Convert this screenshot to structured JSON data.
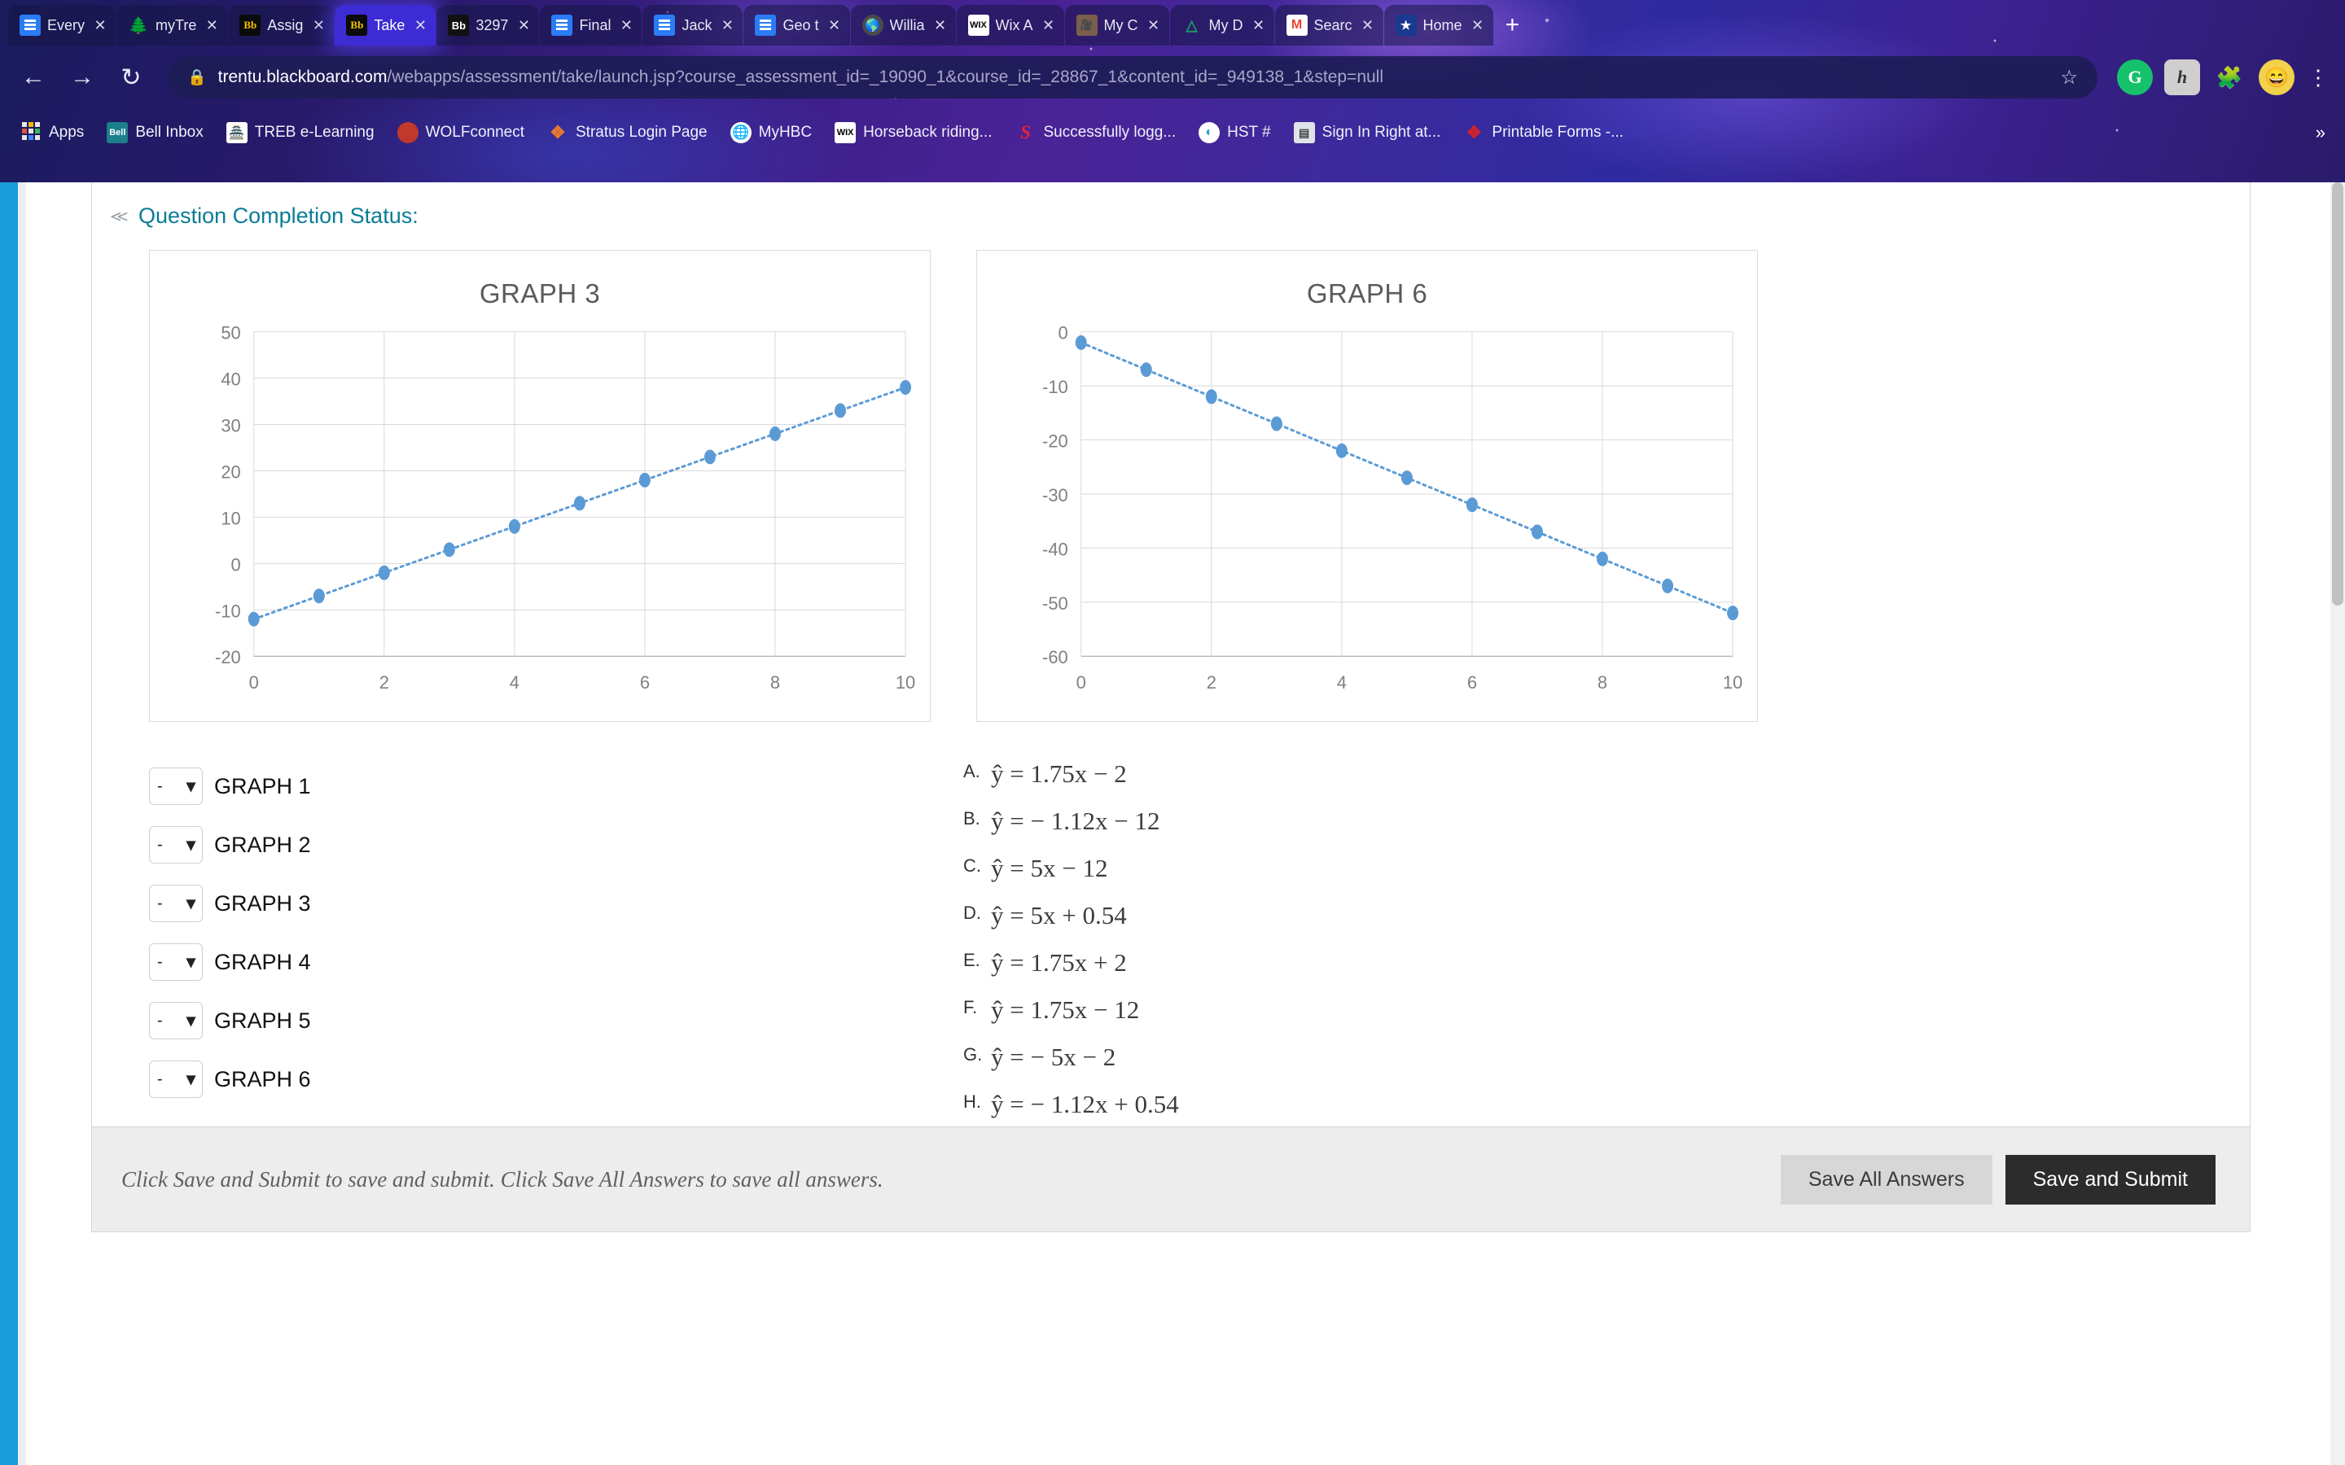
{
  "browser": {
    "tabs": [
      {
        "label": "Every",
        "icon": "google-docs-icon",
        "active": false
      },
      {
        "label": "myTre",
        "icon": "tree-icon",
        "active": false
      },
      {
        "label": "Assig",
        "icon": "blackboard-icon",
        "active": false
      },
      {
        "label": "Take",
        "icon": "blackboard-icon",
        "active": true
      },
      {
        "label": "3297",
        "icon": "blackboard-dark-icon",
        "active": false
      },
      {
        "label": "Final",
        "icon": "google-docs-icon",
        "active": false
      },
      {
        "label": "Jack",
        "icon": "google-docs-icon",
        "active": false
      },
      {
        "label": "Geo t",
        "icon": "google-docs-icon",
        "active": false
      },
      {
        "label": "Willia",
        "icon": "globe-icon",
        "active": false
      },
      {
        "label": "Wix A",
        "icon": "wix-icon",
        "active": false
      },
      {
        "label": "My C",
        "icon": "video-icon",
        "active": false
      },
      {
        "label": "My D",
        "icon": "google-drive-icon",
        "active": false
      },
      {
        "label": "Searc",
        "icon": "gmail-icon",
        "active": false
      },
      {
        "label": "Home",
        "icon": "star-icon",
        "active": false
      }
    ],
    "new_tab_label": "+",
    "tab_close_label": "✕",
    "nav": {
      "back": "←",
      "forward": "→",
      "reload": "↻"
    },
    "omnibox": {
      "lock_icon": "lock-icon",
      "host": "trentu.blackboard.com",
      "path": "/webapps/assessment/take/launch.jsp?course_assessment_id=_19090_1&course_id=_28867_1&content_id=_949138_1&step=null",
      "bookmark_star": "☆"
    },
    "extensions": [
      {
        "name": "grammarly-extension-icon",
        "glyph": "G"
      },
      {
        "name": "hypothesis-extension-icon",
        "glyph": "h"
      },
      {
        "name": "extensions-puzzle-icon",
        "glyph": "🧩"
      },
      {
        "name": "profile-avatar",
        "glyph": "😄"
      }
    ],
    "menu_icon": "⋮",
    "bookmarks": [
      {
        "label": "Apps",
        "icon": "apps-grid-icon"
      },
      {
        "label": "Bell Inbox",
        "icon": "bell-icon",
        "glyph": "Bell"
      },
      {
        "label": "TREB e-Learning",
        "icon": "treb-tower-icon",
        "glyph": "🗼"
      },
      {
        "label": "WOLFconnect",
        "icon": "wolf-icon",
        "glyph": ""
      },
      {
        "label": "Stratus Login Page",
        "icon": "stratus-diamond-icon",
        "glyph": "❖"
      },
      {
        "label": "MyHBC",
        "icon": "globe-icon",
        "glyph": "🌐"
      },
      {
        "label": "Horseback riding...",
        "icon": "wix-icon",
        "glyph": "WIX"
      },
      {
        "label": "Successfully logg...",
        "icon": "s-swirl-icon",
        "glyph": "S"
      },
      {
        "label": "HST #",
        "icon": "hst-icon",
        "glyph": "◔"
      },
      {
        "label": "Sign In   Right at...",
        "icon": "signin-icon",
        "glyph": "▤"
      },
      {
        "label": "Printable Forms -...",
        "icon": "printable-forms-icon",
        "glyph": "❖"
      }
    ],
    "bookmarks_overflow": "»"
  },
  "content": {
    "question_completion_status": "Question Completion Status:",
    "collapse_chevron": "»",
    "graph_labels": [
      "GRAPH 1",
      "GRAPH 2",
      "GRAPH 3",
      "GRAPH 4",
      "GRAPH 5",
      "GRAPH 6"
    ],
    "dropdown_selected": "-",
    "dropdown_caret": "⌄",
    "options": [
      {
        "letter": "A.",
        "equation": "ŷ =  1.75x − 2"
      },
      {
        "letter": "B.",
        "equation": "ŷ = − 1.12x − 12"
      },
      {
        "letter": "C.",
        "equation": "ŷ =  5x − 12"
      },
      {
        "letter": "D.",
        "equation": "ŷ =  5x + 0.54"
      },
      {
        "letter": "E.",
        "equation": "ŷ =  1.75x + 2"
      },
      {
        "letter": "F.",
        "equation": "ŷ = 1.75x − 12"
      },
      {
        "letter": "G.",
        "equation": "ŷ = − 5x − 2"
      },
      {
        "letter": "H.",
        "equation": "ŷ = − 1.12x + 0.54"
      }
    ]
  },
  "footer": {
    "note": "Click Save and Submit to save and submit. Click Save All Answers to save all answers.",
    "save_all_label": "Save All Answers",
    "save_submit_label": "Save and Submit"
  },
  "chart_data": [
    {
      "type": "scatter",
      "title": "GRAPH 3",
      "xlabel": "",
      "ylabel": "",
      "x": [
        0,
        1,
        2,
        3,
        4,
        5,
        6,
        7,
        8,
        9,
        10
      ],
      "values": [
        -12,
        -7,
        -2,
        3,
        8,
        13,
        18,
        23,
        28,
        33,
        38
      ],
      "xlim": [
        0,
        10
      ],
      "ylim": [
        -20,
        50
      ],
      "xticks": [
        0,
        2,
        4,
        6,
        8,
        10
      ],
      "yticks": [
        -20,
        -10,
        0,
        10,
        20,
        30,
        40,
        50
      ],
      "grid": true,
      "legend": "none",
      "marker_color": "#5b9bd5",
      "line_style": "dotted"
    },
    {
      "type": "scatter",
      "title": "GRAPH 6",
      "xlabel": "",
      "ylabel": "",
      "x": [
        0,
        1,
        2,
        3,
        4,
        5,
        6,
        7,
        8,
        9,
        10
      ],
      "values": [
        -2,
        -7,
        -12,
        -17,
        -22,
        -27,
        -32,
        -37,
        -42,
        -47,
        -52
      ],
      "xlim": [
        0,
        10
      ],
      "ylim": [
        -60,
        0
      ],
      "xticks": [
        0,
        2,
        4,
        6,
        8,
        10
      ],
      "yticks": [
        -60,
        -50,
        -40,
        -30,
        -20,
        -10,
        0
      ],
      "grid": true,
      "legend": "none",
      "marker_color": "#5b9bd5",
      "line_style": "dotted"
    }
  ],
  "colors": {
    "accent_teal": "#0b7c97",
    "rail_blue": "#199dd8",
    "chart_blue": "#5b9bd5",
    "primary_button": "#2c2c2c"
  }
}
